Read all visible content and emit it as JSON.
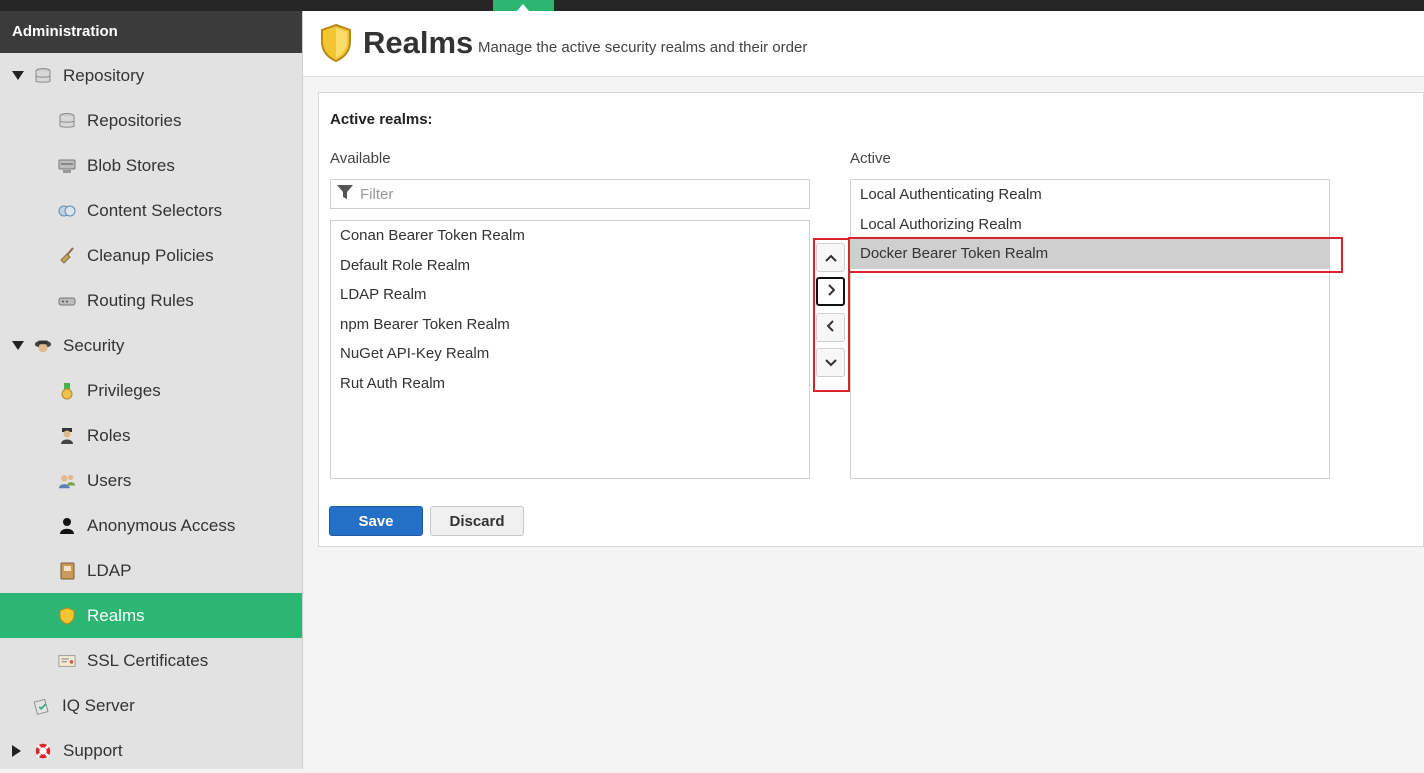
{
  "sidebar": {
    "header": "Administration",
    "items": [
      {
        "label": "Repository",
        "icon": "database-icon",
        "level": 0,
        "expander": "down"
      },
      {
        "label": "Repositories",
        "icon": "database-icon",
        "level": 1
      },
      {
        "label": "Blob Stores",
        "icon": "server-icon",
        "level": 1
      },
      {
        "label": "Content Selectors",
        "icon": "content-selector-icon",
        "level": 1
      },
      {
        "label": "Cleanup Policies",
        "icon": "broom-icon",
        "level": 1
      },
      {
        "label": "Routing Rules",
        "icon": "router-icon",
        "level": 1
      },
      {
        "label": "Security",
        "icon": "security-badge-icon",
        "level": 0,
        "expander": "down"
      },
      {
        "label": "Privileges",
        "icon": "medal-icon",
        "level": 1
      },
      {
        "label": "Roles",
        "icon": "officer-icon",
        "level": 1
      },
      {
        "label": "Users",
        "icon": "users-icon",
        "level": 1
      },
      {
        "label": "Anonymous Access",
        "icon": "person-icon",
        "level": 1
      },
      {
        "label": "LDAP",
        "icon": "address-book-icon",
        "level": 1
      },
      {
        "label": "Realms",
        "icon": "shield-icon",
        "level": 1,
        "active": true
      },
      {
        "label": "SSL Certificates",
        "icon": "certificate-icon",
        "level": 1
      },
      {
        "label": "IQ Server",
        "icon": "iq-server-icon",
        "level": 0
      },
      {
        "label": "Support",
        "icon": "lifebuoy-icon",
        "level": 0,
        "expander": "right"
      }
    ]
  },
  "header": {
    "title": "Realms",
    "subtitle": "Manage the active security realms and their order"
  },
  "panel": {
    "section_label": "Active realms:",
    "available_label": "Available",
    "active_label": "Active",
    "filter_placeholder": "Filter",
    "available": [
      "Conan Bearer Token Realm",
      "Default Role Realm",
      "LDAP Realm",
      "npm Bearer Token Realm",
      "NuGet API-Key Realm",
      "Rut Auth Realm"
    ],
    "active": [
      "Local Authenticating Realm",
      "Local Authorizing Realm",
      "Docker Bearer Token Realm"
    ],
    "selected_active": "Docker Bearer Token Realm",
    "save_label": "Save",
    "discard_label": "Discard"
  },
  "colors": {
    "accent_green": "#2bb673",
    "primary_blue": "#2570c7",
    "highlight_red": "#d9242e",
    "sidebar_dark": "#3b3b3b"
  }
}
